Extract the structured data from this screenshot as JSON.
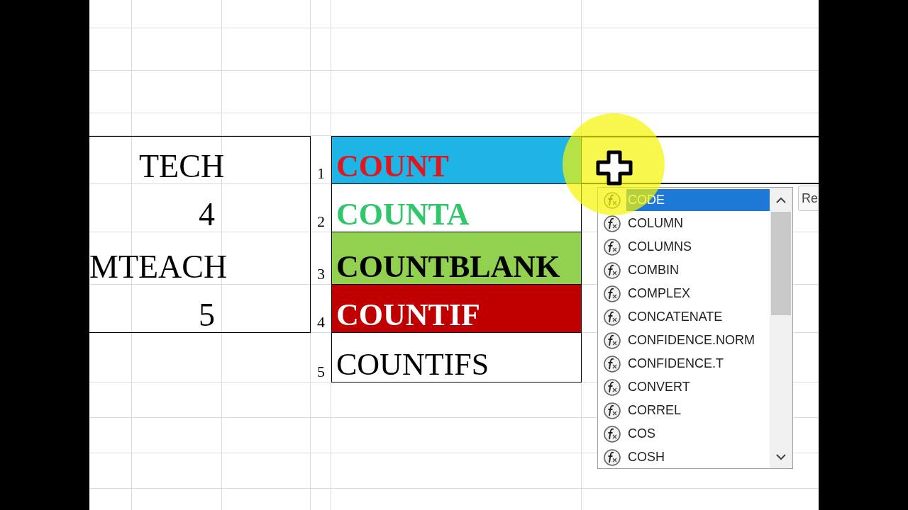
{
  "left_table": {
    "rows": [
      {
        "text": "TECH",
        "kind": "label"
      },
      {
        "text": "4",
        "kind": "number"
      },
      {
        "text": "MTEACH",
        "kind": "label"
      },
      {
        "text": "5",
        "kind": "number"
      }
    ]
  },
  "function_list": [
    {
      "number": "1",
      "name": "COUNT",
      "fill": {
        "color": "#1fb4e6"
      },
      "color": "#e3141c",
      "bold": true
    },
    {
      "number": "2",
      "name": "COUNTA",
      "fill": {
        "color": "#ffffff"
      },
      "color": "#2fc76a",
      "bold": true
    },
    {
      "number": "3",
      "name": "COUNTBLANK",
      "fill": {
        "color": "#92d050"
      },
      "color": "#000000",
      "bold": true
    },
    {
      "number": "4",
      "name": "COUNTIF",
      "fill": {
        "color": "#c00000"
      },
      "color": "#ffffff",
      "bold": true
    },
    {
      "number": "5",
      "name": "COUNTIFS",
      "fill": {
        "color": "#ffffff"
      },
      "color": "#000000",
      "bold": false
    }
  ],
  "autocomplete": {
    "items": [
      {
        "label": "CODE",
        "selected": true
      },
      {
        "label": "COLUMN",
        "selected": false
      },
      {
        "label": "COLUMNS",
        "selected": false
      },
      {
        "label": "COMBIN",
        "selected": false
      },
      {
        "label": "COMPLEX",
        "selected": false
      },
      {
        "label": "CONCATENATE",
        "selected": false
      },
      {
        "label": "CONFIDENCE.NORM",
        "selected": false
      },
      {
        "label": "CONFIDENCE.T",
        "selected": false
      },
      {
        "label": "CONVERT",
        "selected": false
      },
      {
        "label": "CORREL",
        "selected": false
      },
      {
        "label": "COS",
        "selected": false
      },
      {
        "label": "COSH",
        "selected": false
      }
    ]
  },
  "tooltip": {
    "text": "Re"
  }
}
